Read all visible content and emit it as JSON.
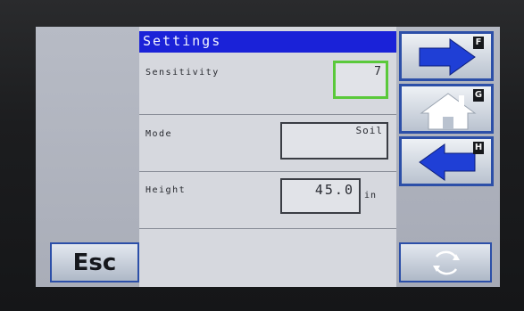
{
  "title": "Settings",
  "esc_label": "Esc",
  "rows": [
    {
      "label": "Sensitivity",
      "value": "7",
      "selected": true
    },
    {
      "label": "Mode",
      "value": "Soil"
    },
    {
      "label": "Height",
      "value": "45.0",
      "unit": "in"
    }
  ],
  "function_keys": [
    {
      "letter": "F",
      "icon": "arrow-right-icon"
    },
    {
      "letter": "G",
      "icon": "home-icon"
    },
    {
      "letter": "H",
      "icon": "arrow-left-icon"
    }
  ],
  "refresh_icon": "refresh-icon",
  "colors": {
    "title_bar": "#1a22d8",
    "arrow_blue": "#1f3fd6",
    "selected_border": "#5ac93b",
    "button_border": "#2c4fa8"
  }
}
